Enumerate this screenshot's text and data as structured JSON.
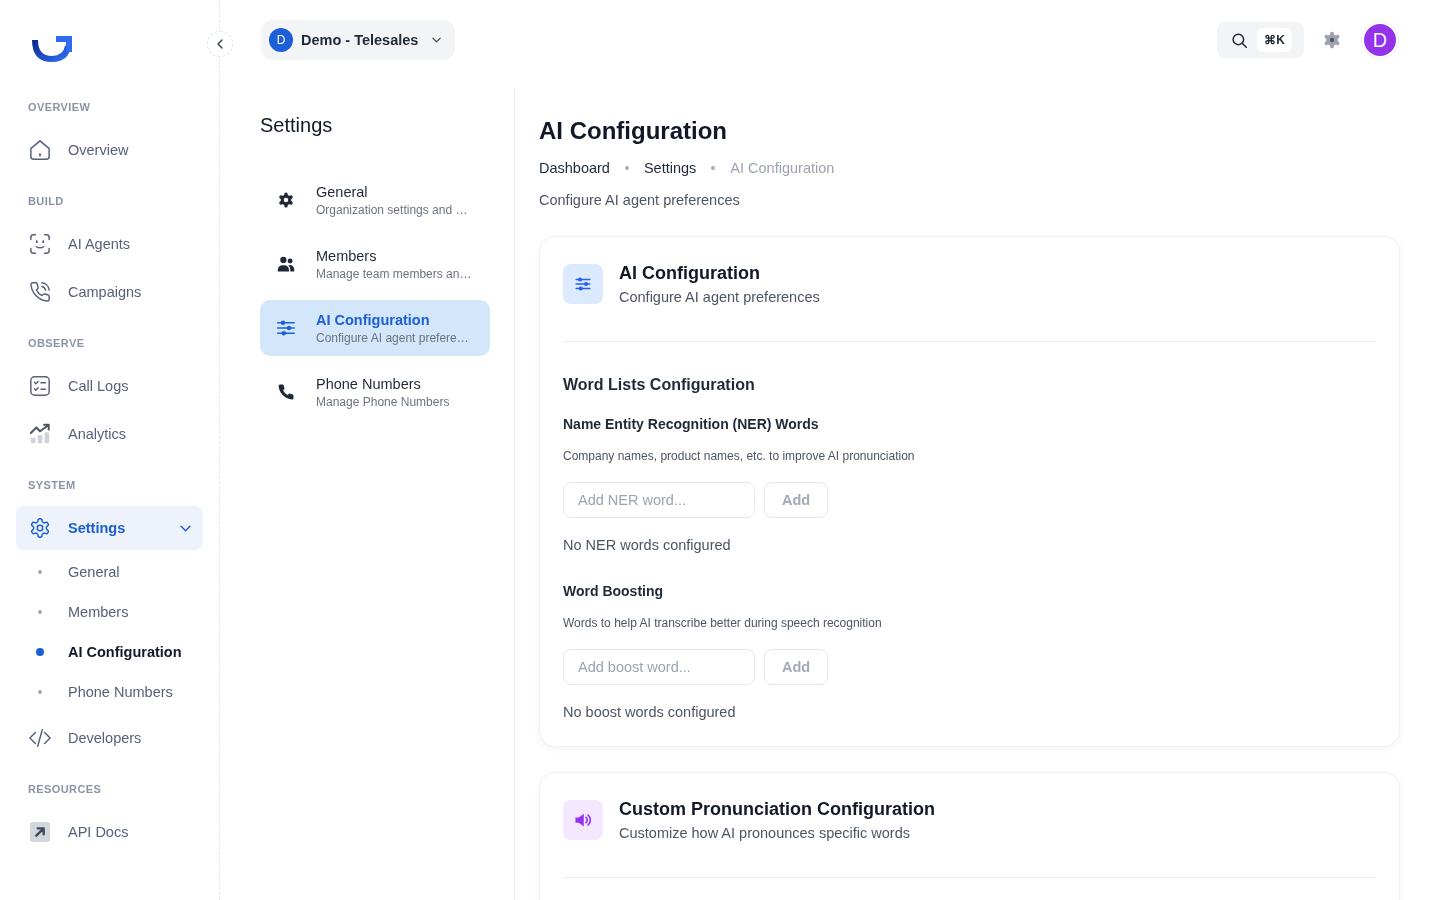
{
  "sidebar": {
    "sections": [
      {
        "label": "OVERVIEW",
        "items": [
          {
            "label": "Overview",
            "selected": false
          }
        ]
      },
      {
        "label": "BUILD",
        "items": [
          {
            "label": "AI Agents",
            "selected": false
          },
          {
            "label": "Campaigns",
            "selected": false
          }
        ]
      },
      {
        "label": "OBSERVE",
        "items": [
          {
            "label": "Call Logs",
            "selected": false
          },
          {
            "label": "Analytics",
            "selected": false
          }
        ]
      },
      {
        "label": "SYSTEM",
        "items": [
          {
            "label": "Settings",
            "selected": true,
            "expanded": true,
            "children": [
              {
                "label": "General",
                "selected": false
              },
              {
                "label": "Members",
                "selected": false
              },
              {
                "label": "AI Configuration",
                "selected": true
              },
              {
                "label": "Phone Numbers",
                "selected": false
              }
            ]
          },
          {
            "label": "Developers",
            "selected": false
          }
        ]
      },
      {
        "label": "RESOURCES",
        "items": [
          {
            "label": "API Docs",
            "selected": false
          }
        ]
      }
    ]
  },
  "topbar": {
    "workspace": {
      "initial": "D",
      "name": "Demo - Telesales"
    },
    "search": {
      "shortcut": "⌘K"
    },
    "user": {
      "initial": "D"
    }
  },
  "settings_nav": {
    "title": "Settings",
    "items": [
      {
        "title": "General",
        "description": "Organization settings and …",
        "selected": false
      },
      {
        "title": "Members",
        "description": "Manage team members an…",
        "selected": false
      },
      {
        "title": "AI Configuration",
        "description": "Configure AI agent prefere…",
        "selected": true
      },
      {
        "title": "Phone Numbers",
        "description": "Manage Phone Numbers",
        "selected": false
      }
    ]
  },
  "page": {
    "title": "AI Configuration",
    "breadcrumb": [
      {
        "label": "Dashboard",
        "current": false
      },
      {
        "label": "Settings",
        "current": false
      },
      {
        "label": "AI Configuration",
        "current": true
      }
    ],
    "subtitle": "Configure AI agent preferences"
  },
  "cards": [
    {
      "title": "AI Configuration",
      "subtitle": "Configure AI agent preferences",
      "section_title": "Word Lists Configuration",
      "word_lists": [
        {
          "title": "Name Entity Recognition (NER) Words",
          "description": "Company names, product names, etc. to improve AI pronunciation",
          "input": {
            "placeholder": "Add NER word..."
          },
          "button": {
            "label": "Add",
            "disabled": true
          },
          "empty_text": "No NER words configured"
        },
        {
          "title": "Word Boosting",
          "description": "Words to help AI transcribe better during speech recognition",
          "input": {
            "placeholder": "Add boost word..."
          },
          "button": {
            "label": "Add",
            "disabled": true
          },
          "empty_text": "No boost words configured"
        }
      ]
    },
    {
      "title": "Custom Pronunciation Configuration",
      "subtitle": "Customize how AI pronounces specific words"
    }
  ]
}
